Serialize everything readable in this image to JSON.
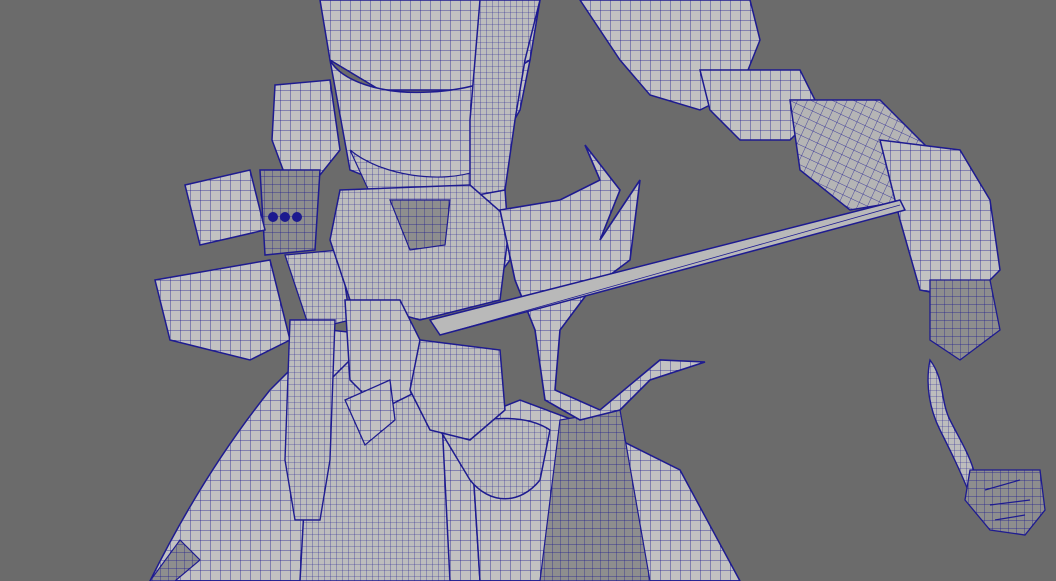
{
  "viewport": {
    "background_color": "#6b6b6b",
    "mesh_color": "#c7c7c7",
    "wire_color": "#1c1a8f",
    "shade_color": "#8d8d8d",
    "display_mode": "wireframe-on-shaded"
  },
  "scene": {
    "subject": "character-mesh",
    "parts": [
      "torso",
      "belt",
      "left-arm-gauntlet",
      "right-arm",
      "hand-with-dagger",
      "skull-ornament",
      "horned-weapon",
      "spear-blade",
      "leg-armor",
      "braided-tail",
      "tassel"
    ]
  }
}
